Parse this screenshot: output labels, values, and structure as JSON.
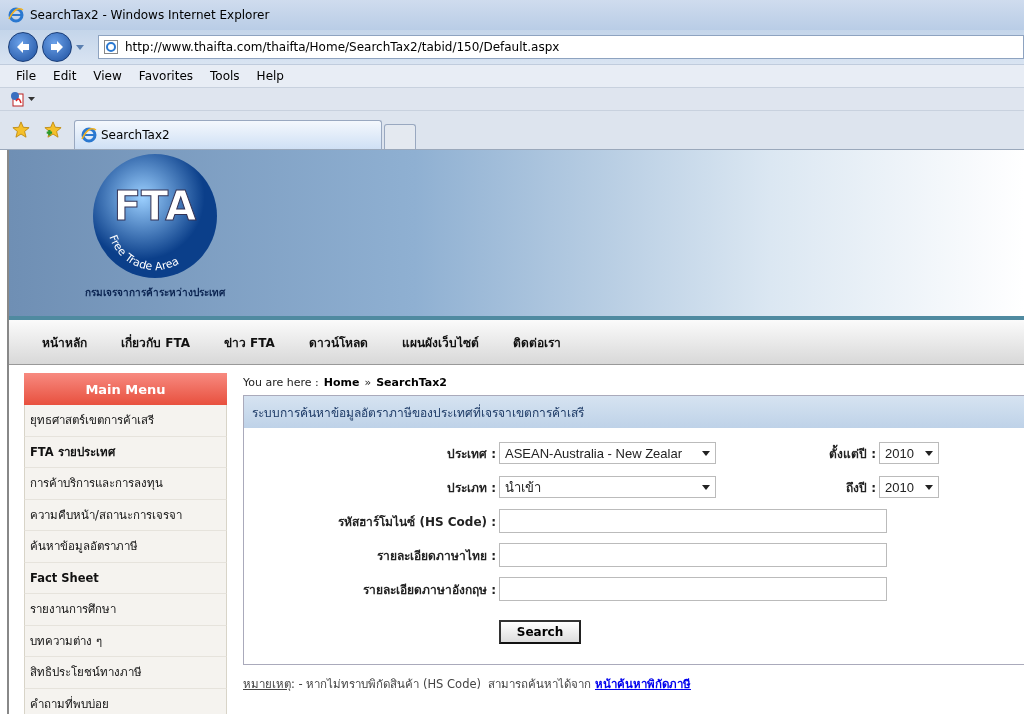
{
  "window": {
    "title": "SearchTax2 - Windows Internet Explorer"
  },
  "address_bar": {
    "url": "http://www.thaifta.com/thaifta/Home/SearchTax2/tabid/150/Default.aspx"
  },
  "menu_bar": [
    "File",
    "Edit",
    "View",
    "Favorites",
    "Tools",
    "Help"
  ],
  "tabs": [
    {
      "label": "SearchTax2",
      "selected": true
    }
  ],
  "logo": {
    "title": "FTA",
    "subtitle": "Free Trade Area",
    "org": "กรมเจรจาการค้าระหว่างประเทศ"
  },
  "nav": [
    "หน้าหลัก",
    "เกี่ยวกับ FTA",
    "ข่าว FTA",
    "ดาวน์โหลด",
    "แผนผังเว็บไซต์",
    "ติดต่อเรา"
  ],
  "breadcrumb": {
    "prefix": "You are here :",
    "items": [
      "Home",
      "SearchTax2"
    ],
    "separator": "»"
  },
  "main_menu": {
    "title": "Main Menu",
    "items": [
      {
        "label": "ยุทธศาสตร์เขตการค้าเสรี",
        "bold": false
      },
      {
        "label": "FTA รายประเทศ",
        "bold": true
      },
      {
        "label": "การค้าบริการและการลงทุน",
        "bold": false
      },
      {
        "label": "ความคืบหน้า/สถานะการเจรจา",
        "bold": false
      },
      {
        "label": "ค้นหาข้อมูลอัตราภาษี",
        "bold": false
      },
      {
        "label": "Fact Sheet",
        "bold": true
      },
      {
        "label": "รายงานการศึกษา",
        "bold": false
      },
      {
        "label": "บทความต่าง ๆ",
        "bold": false
      },
      {
        "label": "สิทธิประโยชน์ทางภาษี",
        "bold": false
      },
      {
        "label": "คำถามที่พบบ่อย",
        "bold": false
      }
    ]
  },
  "search_panel": {
    "title": "ระบบการค้นหาข้อมูลอัตราภาษีของประเทศที่เจรจาเขตการค้าเสรี",
    "fields": [
      {
        "kind": "select",
        "label": "ประเทศ :",
        "value": "ASEAN-Australia - New Zealar",
        "extra": {
          "label": "ตั้งแต่ปี :",
          "value": "2010"
        }
      },
      {
        "kind": "select",
        "label": "ประเภท :",
        "value": "นำเข้า",
        "extra": {
          "label": "ถึงปี :",
          "value": "2010"
        }
      },
      {
        "kind": "text",
        "label": "รหัสฮาร์โมไนซ์ (HS Code) :"
      },
      {
        "kind": "text",
        "label": "รายละเอียดภาษาไทย :"
      },
      {
        "kind": "text",
        "label": "รายละเอียดภาษาอังกฤษ :"
      }
    ],
    "button": "Search"
  },
  "note": {
    "label": "หมายเหตุ",
    "text": ": - หากไม่ทราบพิกัดสินค้า (HS Code)  สามารถค้นหาได้จาก",
    "link": "หน้าค้นหาพิกัดภาษี"
  }
}
